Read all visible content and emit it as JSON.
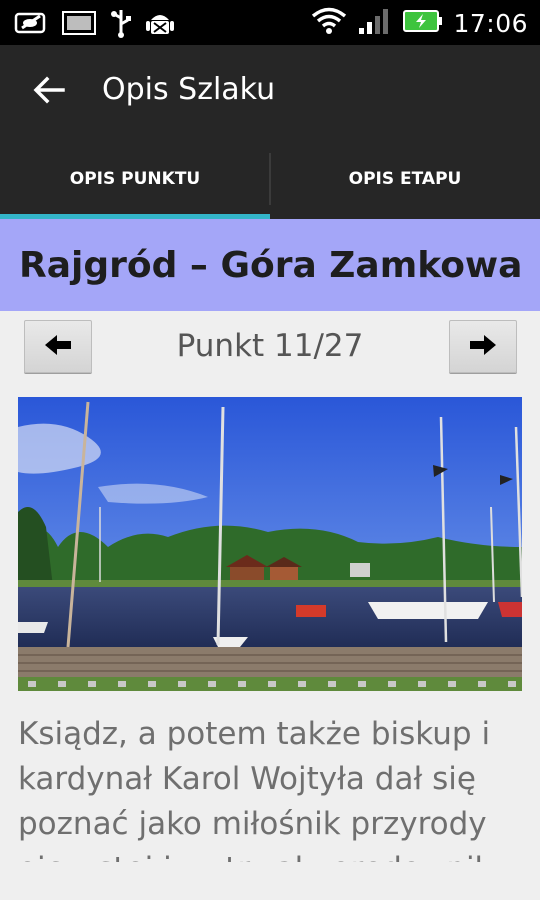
{
  "status_bar": {
    "time": "17:06",
    "icons_left": [
      "eye-slash-icon",
      "image-icon",
      "usb-icon",
      "android-debug-icon"
    ],
    "icons_right": [
      "wifi-icon",
      "signal-icon",
      "battery-charging-icon"
    ]
  },
  "action_bar": {
    "title": "Opis Szlaku",
    "back_icon": "arrow-left-icon"
  },
  "tabs": [
    {
      "label": "OPIS PUNKTU",
      "active": true
    },
    {
      "label": "OPIS ETAPU",
      "active": false
    }
  ],
  "colors": {
    "accent": "#33b5c9",
    "title_band": "#a4a6f8",
    "action_bar": "#262626"
  },
  "page": {
    "title": "Rajgród – Góra Zamkowa",
    "point_label": "Punkt 11/27",
    "prev_icon": "arrow-left-icon",
    "next_icon": "arrow-right-icon",
    "description": "Ksiądz, a potem także biskup i kardynał Karol Wojtyła dał się poznać jako miłośnik przyrody ojczystej i wytrwały orędownik"
  }
}
